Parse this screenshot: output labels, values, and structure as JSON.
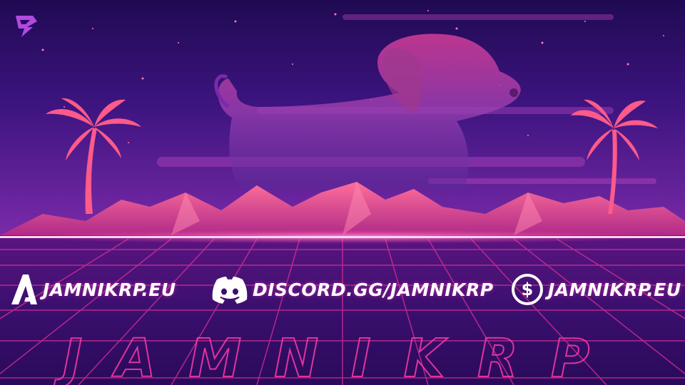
{
  "links": {
    "website": {
      "text": "JAMNIKRP.EU",
      "icon": "jamnik-a-logo-icon"
    },
    "discord": {
      "text": "DISCORD.GG/JAMNIKRP",
      "icon": "discord-icon"
    },
    "store": {
      "text": "JAMNIKRP.EU",
      "icon": "dollar-coin-icon"
    }
  },
  "wordmark": {
    "text": "JAMNIKRP"
  },
  "corner_logo": {
    "icon": "streamer-logo-icon"
  },
  "colors": {
    "sky_top": "#220a55",
    "sky_mid": "#5a1a8e",
    "horizon_glow": "#ff7ad6",
    "neon_pink": "#ff2f9a",
    "grid": "#e0309a",
    "mountain": "#f0508f",
    "palm": "#ff5a8a",
    "dog": "#c04fb0"
  }
}
